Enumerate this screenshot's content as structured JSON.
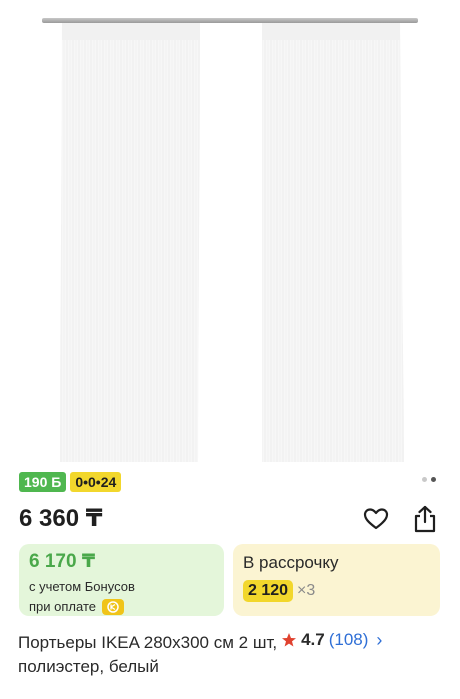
{
  "product": {
    "image_alt": "curtains",
    "bonus_badge": "190 Б",
    "installment_badge": "0•0•24",
    "price": "6 360 ₸",
    "bonus_card": {
      "price": "6 170 ₸",
      "line1": "с учетом Бонусов",
      "line2": "при оплате"
    },
    "installment_card": {
      "title": "В рассрочку",
      "amount": "2 120",
      "multiplier": "×3"
    },
    "title_line1": "Портьеры IKEA 280х300 см 2 шт,",
    "title_line2": "полиэстер, белый",
    "rating": "4.7",
    "reviews": "(108)"
  },
  "colors": {
    "bonus_green": "#4fb74f",
    "installment_yellow": "#f2d72c",
    "link_blue": "#2f6fd6",
    "star_red": "#e0422f"
  },
  "icons": [
    "heart-icon",
    "share-icon",
    "star-icon",
    "chevron-right-icon",
    "kaspi-pay-icon"
  ]
}
